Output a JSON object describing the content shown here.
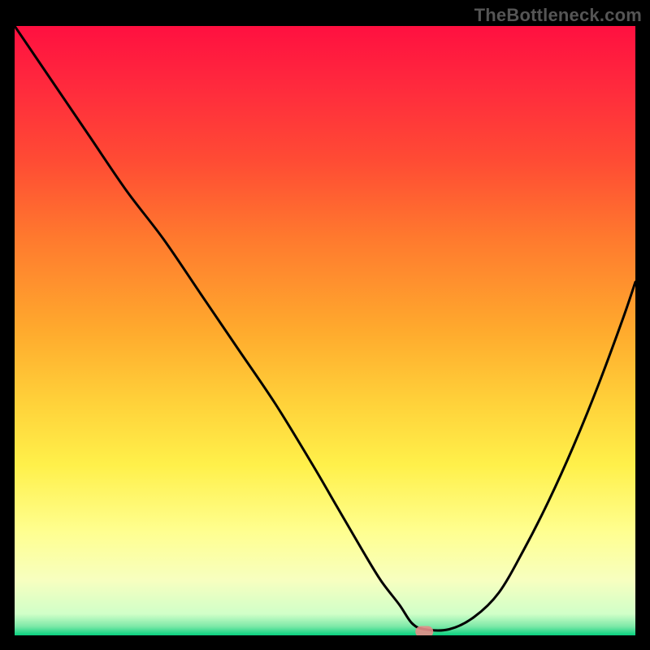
{
  "watermark": "TheBottleneck.com",
  "colors": {
    "gradient_stops": [
      {
        "offset": 0.0,
        "color": "#ff1040"
      },
      {
        "offset": 0.1,
        "color": "#ff2a3d"
      },
      {
        "offset": 0.22,
        "color": "#ff4b34"
      },
      {
        "offset": 0.35,
        "color": "#ff7a2e"
      },
      {
        "offset": 0.5,
        "color": "#ffaa2d"
      },
      {
        "offset": 0.62,
        "color": "#ffd23a"
      },
      {
        "offset": 0.72,
        "color": "#fff04a"
      },
      {
        "offset": 0.83,
        "color": "#ffff90"
      },
      {
        "offset": 0.91,
        "color": "#f7ffc0"
      },
      {
        "offset": 0.965,
        "color": "#d0ffc8"
      },
      {
        "offset": 0.985,
        "color": "#7ee9a8"
      },
      {
        "offset": 1.0,
        "color": "#08d07f"
      }
    ],
    "curve": "#000000",
    "frame": "#000000",
    "marker": "#e68d8a"
  },
  "chart_data": {
    "type": "line",
    "title": "",
    "xlabel": "",
    "ylabel": "",
    "xlim": [
      0,
      100
    ],
    "ylim": [
      0,
      100
    ],
    "grid": false,
    "legend": false,
    "annotations": [],
    "series": [
      {
        "name": "bottleneck-curve",
        "x": [
          0,
          6,
          12,
          18,
          24,
          30,
          36,
          42,
          48,
          52,
          56,
          59,
          62,
          64,
          66,
          70,
          74,
          78,
          82,
          86,
          90,
          94,
          98,
          100
        ],
        "values": [
          100,
          91,
          82,
          73,
          65,
          56,
          47,
          38,
          28,
          21,
          14,
          9,
          5,
          2,
          1,
          1,
          3,
          7,
          14,
          22,
          31,
          41,
          52,
          58
        ]
      }
    ],
    "markers": [
      {
        "name": "optimal-point",
        "x": 66,
        "y": 0.6
      }
    ]
  }
}
